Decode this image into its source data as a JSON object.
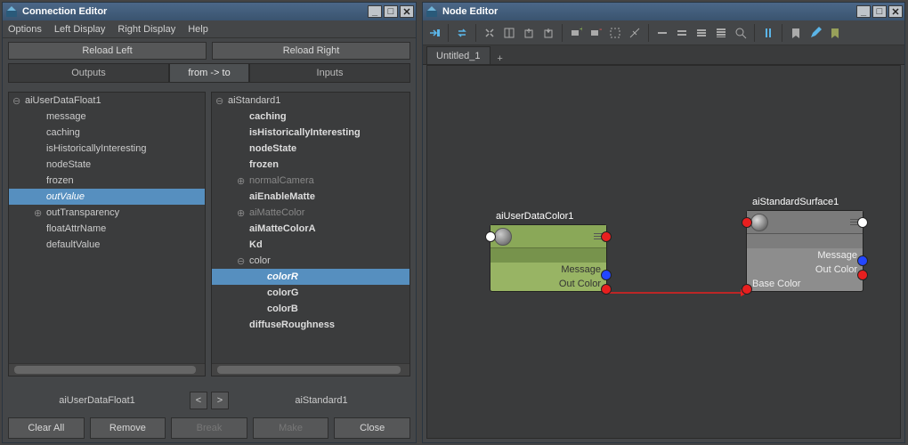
{
  "conn": {
    "title": "Connection Editor",
    "menus": [
      "Options",
      "Left Display",
      "Right Display",
      "Help"
    ],
    "reloadLeft": "Reload Left",
    "reloadRight": "Reload Right",
    "cols": {
      "outputs": "Outputs",
      "fromto": "from -> to",
      "inputs": "Inputs"
    },
    "leftTree": {
      "root": "aiUserDataFloat1",
      "items": [
        {
          "label": "message"
        },
        {
          "label": "caching"
        },
        {
          "label": "isHistoricallyInteresting"
        },
        {
          "label": "nodeState"
        },
        {
          "label": "frozen"
        },
        {
          "label": "outValue",
          "selected": true,
          "italic": true
        },
        {
          "label": "outTransparency",
          "expand": "plus"
        },
        {
          "label": "floatAttrName"
        },
        {
          "label": "defaultValue"
        }
      ]
    },
    "rightTree": {
      "root": "aiStandard1",
      "items": [
        {
          "label": "caching",
          "bold": true
        },
        {
          "label": "isHistoricallyInteresting",
          "bold": true
        },
        {
          "label": "nodeState",
          "bold": true
        },
        {
          "label": "frozen",
          "bold": true
        },
        {
          "label": "normalCamera",
          "expand": "plus",
          "dim": true
        },
        {
          "label": "aiEnableMatte",
          "bold": true
        },
        {
          "label": "aiMatteColor",
          "expand": "plus",
          "dim": true
        },
        {
          "label": "aiMatteColorA",
          "bold": true
        },
        {
          "label": "Kd",
          "bold": true
        },
        {
          "label": "color",
          "expand": "minus"
        },
        {
          "label": "colorR",
          "level": 3,
          "selected": true,
          "bold": true,
          "italic": true
        },
        {
          "label": "colorG",
          "level": 3,
          "bold": true
        },
        {
          "label": "colorB",
          "level": 3,
          "bold": true
        },
        {
          "label": "diffuseRoughness",
          "bold": true
        }
      ]
    },
    "footerLeft": "aiUserDataFloat1",
    "footerRight": "aiStandard1",
    "arrows": {
      "left": "<",
      "right": ">"
    },
    "buttons": {
      "clear": "Clear All",
      "remove": "Remove",
      "break": "Break",
      "make": "Make",
      "close": "Close"
    }
  },
  "ne": {
    "title": "Node Editor",
    "tab": "Untitled_1",
    "nodes": {
      "a": {
        "title": "aiUserDataColor1",
        "attrs": [
          "Message",
          "Out Color"
        ]
      },
      "b": {
        "title": "aiStandardSurface1",
        "attrs": [
          "Message",
          "Out Color",
          "Base Color"
        ]
      }
    }
  }
}
